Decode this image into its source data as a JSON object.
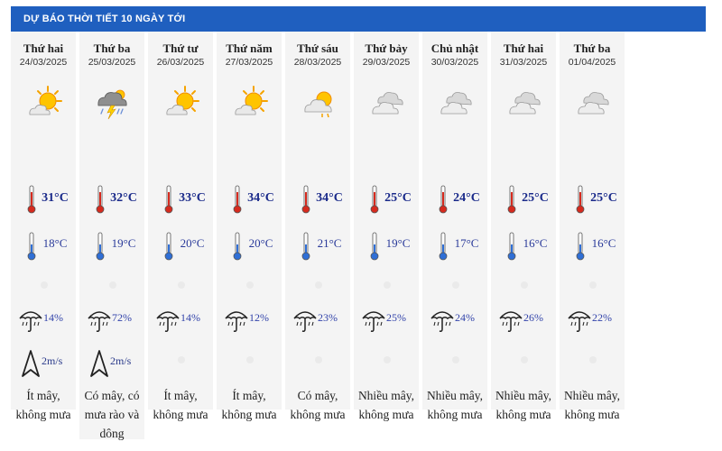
{
  "header": {
    "title": "Dự báo thời tiết 10 ngày tới"
  },
  "days": [
    {
      "name": "Thứ hai",
      "date": "24/03/2025",
      "icon": "sun-cloud-icon",
      "tmax": "31°C",
      "tmin": "18°C",
      "rain": "14%",
      "wind": "2m/s",
      "desc": "Ít mây, không mưa"
    },
    {
      "name": "Thứ ba",
      "date": "25/03/2025",
      "icon": "thunderstorm-icon",
      "tmax": "32°C",
      "tmin": "19°C",
      "rain": "72%",
      "wind": "2m/s",
      "desc": "Có mây, có mưa rào và dông"
    },
    {
      "name": "Thứ tư",
      "date": "26/03/2025",
      "icon": "sun-cloud-icon",
      "tmax": "33°C",
      "tmin": "20°C",
      "rain": "14%",
      "wind": "",
      "desc": "Ít mây, không mưa"
    },
    {
      "name": "Thứ năm",
      "date": "27/03/2025",
      "icon": "sun-cloud-icon",
      "tmax": "34°C",
      "tmin": "20°C",
      "rain": "12%",
      "wind": "",
      "desc": "Ít mây, không mưa"
    },
    {
      "name": "Thứ sáu",
      "date": "28/03/2025",
      "icon": "cloud-sun-icon",
      "tmax": "34°C",
      "tmin": "21°C",
      "rain": "23%",
      "wind": "",
      "desc": "Có mây, không mưa"
    },
    {
      "name": "Thứ bảy",
      "date": "29/03/2025",
      "icon": "clouds-icon",
      "tmax": "25°C",
      "tmin": "19°C",
      "rain": "25%",
      "wind": "",
      "desc": "Nhiều mây, không mưa"
    },
    {
      "name": "Chủ nhật",
      "date": "30/03/2025",
      "icon": "clouds-icon",
      "tmax": "24°C",
      "tmin": "17°C",
      "rain": "24%",
      "wind": "",
      "desc": "Nhiều mây, không mưa"
    },
    {
      "name": "Thứ hai",
      "date": "31/03/2025",
      "icon": "clouds-icon",
      "tmax": "25°C",
      "tmin": "16°C",
      "rain": "26%",
      "wind": "",
      "desc": "Nhiều mây, không mưa"
    },
    {
      "name": "Thứ ba",
      "date": "01/04/2025",
      "icon": "clouds-icon",
      "tmax": "25°C",
      "tmin": "16°C",
      "rain": "22%",
      "wind": "",
      "desc": "Nhiều mây, không mưa"
    }
  ]
}
